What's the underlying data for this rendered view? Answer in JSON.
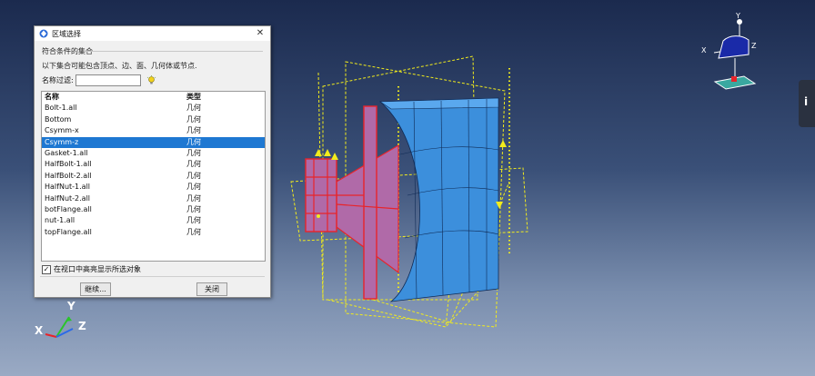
{
  "dialog": {
    "title": "区域选择",
    "close_glyph": "✕",
    "group_label": "符合条件的集合",
    "description": "以下集合可能包含顶点、边、面、几何体或节点.",
    "filter_label": "名称过滤:",
    "filter_value": "",
    "columns": [
      "名称",
      "类型"
    ],
    "rows": [
      {
        "name": "Bolt-1.all",
        "type": "几何"
      },
      {
        "name": "Bottom",
        "type": "几何"
      },
      {
        "name": "Csymm-x",
        "type": "几何"
      },
      {
        "name": "Csymm-z",
        "type": "几何"
      },
      {
        "name": "Gasket-1.all",
        "type": "几何"
      },
      {
        "name": "HalfBolt-1.all",
        "type": "几何"
      },
      {
        "name": "HalfBolt-2.all",
        "type": "几何"
      },
      {
        "name": "HalfNut-1.all",
        "type": "几何"
      },
      {
        "name": "HalfNut-2.all",
        "type": "几何"
      },
      {
        "name": "botFlange.all",
        "type": "几何"
      },
      {
        "name": "nut-1.all",
        "type": "几何"
      },
      {
        "name": "topFlange.all",
        "type": "几何"
      }
    ],
    "selected_row": "Csymm-z",
    "highlight_checkbox_checked": true,
    "highlight_label": "在视口中高亮显示所选对象",
    "continue_label": "继续...",
    "close_label": "关闭"
  },
  "triad_top": {
    "x": "X",
    "y": "Y",
    "z": "Z"
  },
  "triad_bottom": {
    "x": "X",
    "y": "Y",
    "z": "Z"
  },
  "side_tab_label": "i",
  "colors": {
    "model_blue": "#3c8fdc",
    "flange_magenta": "#b06aa8",
    "edge_red": "#e8242a",
    "constraint_yellow": "#f2ec1c",
    "selection_blue": "#1e78d2"
  }
}
